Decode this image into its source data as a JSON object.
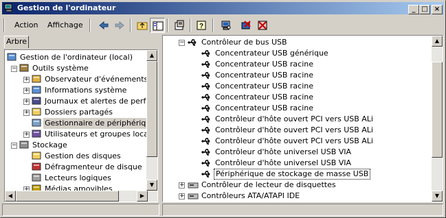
{
  "window": {
    "title": "Gestion de l'ordinateur"
  },
  "title_buttons": {
    "minimize": "_",
    "maximize": "□",
    "close": "×"
  },
  "menu": {
    "action": "Action",
    "view": "Affichage"
  },
  "toolbar_icons": [
    "back-arrow-icon",
    "forward-arrow-icon",
    "up-folder-icon",
    "show-hide-tree-icon",
    "properties-icon",
    "help-icon",
    "scan-hardware-icon",
    "uninstall-device-icon",
    "disable-device-icon"
  ],
  "left_tab": "Arbre",
  "tree": [
    {
      "label": "Gestion de l'ordinateur (local)",
      "depth": 0,
      "icon": "computer-icon",
      "exp": ""
    },
    {
      "label": "Outils système",
      "depth": 1,
      "icon": "tools-icon",
      "exp": "-"
    },
    {
      "label": "Observateur d'événements",
      "depth": 2,
      "icon": "event-viewer-icon",
      "exp": "+"
    },
    {
      "label": "Informations système",
      "depth": 2,
      "icon": "system-info-icon",
      "exp": "+"
    },
    {
      "label": "Journaux et alertes de perfor",
      "depth": 2,
      "icon": "performance-logs-icon",
      "exp": "+"
    },
    {
      "label": "Dossiers partagés",
      "depth": 2,
      "icon": "shared-folder-icon",
      "exp": "+"
    },
    {
      "label": "Gestionnaire de périphériques",
      "depth": 2,
      "icon": "device-manager-icon",
      "exp": "",
      "highlight": true
    },
    {
      "label": "Utilisateurs et groupes locaux",
      "depth": 2,
      "icon": "users-icon",
      "exp": "+"
    },
    {
      "label": "Stockage",
      "depth": 1,
      "icon": "storage-icon",
      "exp": "-"
    },
    {
      "label": "Gestion des disques",
      "depth": 2,
      "icon": "disk-management-icon",
      "exp": ""
    },
    {
      "label": "Défragmenteur de disque",
      "depth": 2,
      "icon": "defrag-icon",
      "exp": ""
    },
    {
      "label": "Lecteurs logiques",
      "depth": 2,
      "icon": "logical-drive-icon",
      "exp": ""
    },
    {
      "label": "Médias amovibles",
      "depth": 2,
      "icon": "removable-media-icon",
      "exp": "+"
    }
  ],
  "devices": {
    "category": "Contrôleur de bus USB",
    "items": [
      "Concentrateur USB générique",
      "Concentrateur USB racine",
      "Concentrateur USB racine",
      "Concentrateur USB racine",
      "Concentrateur USB racine",
      "Concentrateur USB racine",
      "Contrôleur d'hôte ouvert PCI vers USB ALi",
      "Contrôleur d'hôte ouvert PCI vers USB ALi",
      "Contrôleur d'hôte ouvert PCI vers USB ALi",
      "Contrôleur d'hôte universel USB VIA",
      "Contrôleur d'hôte universel USB VIA",
      "Périphérique de stockage de masse USB"
    ],
    "selected_index": 11,
    "after": [
      "Contrôleur de lecteur de disquettes",
      "Contrôleurs ATA/ATAPI IDE"
    ]
  }
}
